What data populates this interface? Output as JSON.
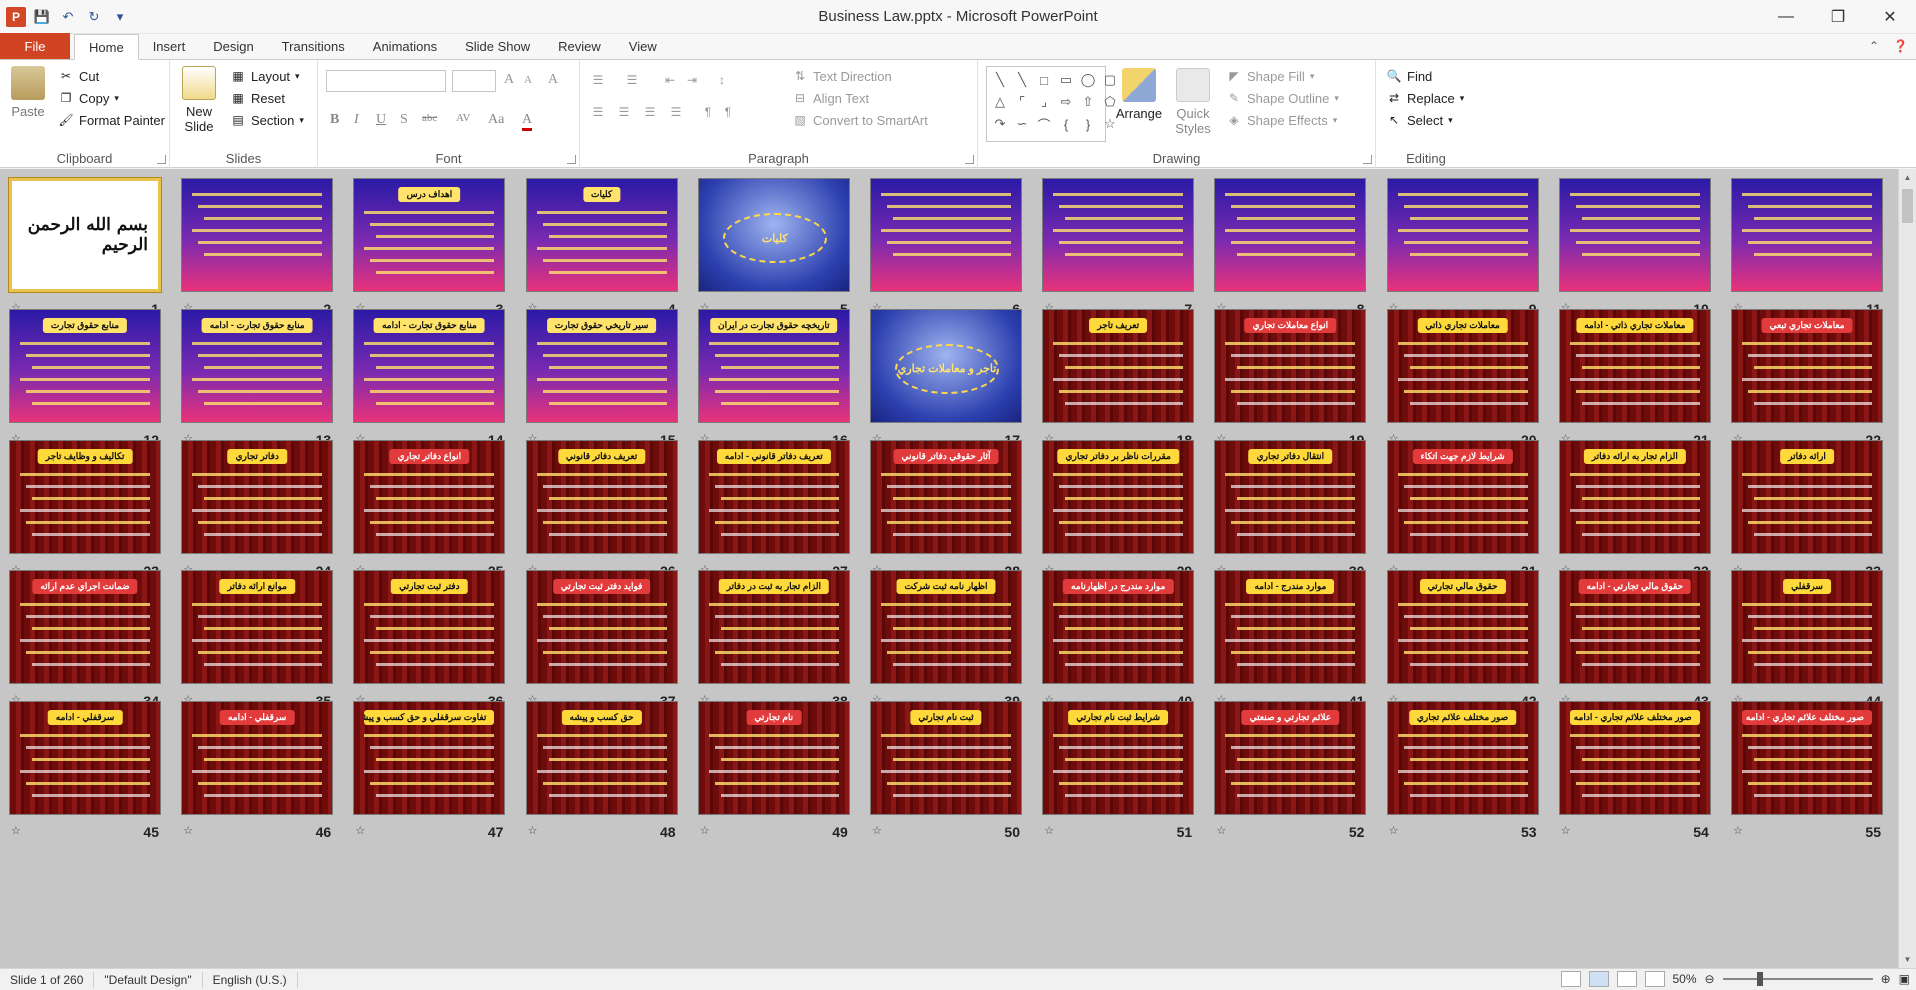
{
  "window": {
    "title": "Business Law.pptx  -  Microsoft PowerPoint"
  },
  "qat": {
    "icons": [
      "powerpoint-logo-icon",
      "save-icon",
      "undo-icon",
      "redo-icon",
      "customize-icon"
    ]
  },
  "tabs": [
    "File",
    "Home",
    "Insert",
    "Design",
    "Transitions",
    "Animations",
    "Slide Show",
    "Review",
    "View"
  ],
  "active_tab": "Home",
  "ribbon": {
    "clipboard": {
      "label": "Clipboard",
      "paste": "Paste",
      "cut": "Cut",
      "copy": "Copy",
      "format_painter": "Format Painter"
    },
    "slides": {
      "label": "Slides",
      "new_slide": "New Slide",
      "layout": "Layout",
      "reset": "Reset",
      "section": "Section"
    },
    "font": {
      "label": "Font",
      "bold": "B",
      "italic": "I",
      "underline": "U",
      "strike": "S",
      "shadow": "abc",
      "spacing": "AV",
      "case": "Aa",
      "color": "A",
      "grow": "A",
      "shrink": "A",
      "clear": "A"
    },
    "paragraph": {
      "label": "Paragraph",
      "text_direction": "Text Direction",
      "align_text": "Align Text",
      "convert_smartart": "Convert to SmartArt"
    },
    "drawing": {
      "label": "Drawing",
      "arrange": "Arrange",
      "quick_styles": "Quick Styles",
      "shape_fill": "Shape Fill",
      "shape_outline": "Shape Outline",
      "shape_effects": "Shape Effects"
    },
    "editing": {
      "label": "Editing",
      "find": "Find",
      "replace": "Replace",
      "select": "Select"
    }
  },
  "slides": [
    {
      "n": "1",
      "bg": "white",
      "title": "بسم الله الرحمن الرحيم"
    },
    {
      "n": "2",
      "bg": "purple"
    },
    {
      "n": "3",
      "bg": "purple",
      "title": "اهداف درس"
    },
    {
      "n": "4",
      "bg": "purple",
      "title": "كليات"
    },
    {
      "n": "5",
      "bg": "blue",
      "center": "كليات"
    },
    {
      "n": "6",
      "bg": "purple"
    },
    {
      "n": "7",
      "bg": "purple"
    },
    {
      "n": "8",
      "bg": "purple"
    },
    {
      "n": "9",
      "bg": "purple"
    },
    {
      "n": "10",
      "bg": "purple"
    },
    {
      "n": "11",
      "bg": "purple"
    },
    {
      "n": "12",
      "bg": "purple",
      "title": "منابع حقوق تجارت"
    },
    {
      "n": "13",
      "bg": "purple",
      "title": "منابع حقوق تجارت - ادامه"
    },
    {
      "n": "14",
      "bg": "purple",
      "title": "منابع حقوق تجارت - ادامه"
    },
    {
      "n": "15",
      "bg": "purple",
      "title": "سير تاريخي حقوق تجارت"
    },
    {
      "n": "16",
      "bg": "purple",
      "title": "تاريخچه حقوق تجارت در ايران"
    },
    {
      "n": "17",
      "bg": "blue",
      "center": "تاجر و معاملات تجاري"
    },
    {
      "n": "18",
      "bg": "red",
      "title": "تعريف تاجر"
    },
    {
      "n": "19",
      "bg": "red",
      "title": "انواع معاملات تجاري"
    },
    {
      "n": "20",
      "bg": "red",
      "title": "معاملات تجاري ذاتي"
    },
    {
      "n": "21",
      "bg": "red",
      "title": "معاملات تجاري ذاتي - ادامه"
    },
    {
      "n": "22",
      "bg": "red",
      "title": "معاملات تجاري تبعي"
    },
    {
      "n": "23",
      "bg": "red",
      "title": "تكاليف و وظايف تاجر"
    },
    {
      "n": "24",
      "bg": "red",
      "title": "دفاتر تجاري"
    },
    {
      "n": "25",
      "bg": "red",
      "title": "انواع دفاتر تجاري"
    },
    {
      "n": "26",
      "bg": "red",
      "title": "تعريف دفاتر قانوني"
    },
    {
      "n": "27",
      "bg": "red",
      "title": "تعريف دفاتر قانوني - ادامه"
    },
    {
      "n": "28",
      "bg": "red",
      "title": "آثار حقوقي دفاتر قانوني"
    },
    {
      "n": "29",
      "bg": "red",
      "title": "مقررات ناظر بر دفاتر تجاري"
    },
    {
      "n": "30",
      "bg": "red",
      "title": "انتقال دفاتر تجاري"
    },
    {
      "n": "31",
      "bg": "red",
      "title": "شرايط لازم جهت اتكاء"
    },
    {
      "n": "32",
      "bg": "red",
      "title": "الزام تجار به ارائه دفاتر"
    },
    {
      "n": "33",
      "bg": "red",
      "title": "ارائه دفاتر"
    },
    {
      "n": "34",
      "bg": "red",
      "title": "ضمانت اجراي عدم ارائه"
    },
    {
      "n": "35",
      "bg": "red",
      "title": "موانع ارائه دفاتر"
    },
    {
      "n": "36",
      "bg": "red",
      "title": "دفتر ثبت تجارتي"
    },
    {
      "n": "37",
      "bg": "red",
      "title": "فوايد دفتر ثبت تجارتي"
    },
    {
      "n": "38",
      "bg": "red",
      "title": "الزام تجار به ثبت در دفاتر"
    },
    {
      "n": "39",
      "bg": "red",
      "title": "اظهار نامه ثبت شركت"
    },
    {
      "n": "40",
      "bg": "red",
      "title": "موارد مندرج در اظهارنامه"
    },
    {
      "n": "41",
      "bg": "red",
      "title": "موارد مندرج - ادامه"
    },
    {
      "n": "42",
      "bg": "red",
      "title": "حقوق مالي تجارتي"
    },
    {
      "n": "43",
      "bg": "red",
      "title": "حقوق مالي تجارتي - ادامه"
    },
    {
      "n": "44",
      "bg": "red",
      "title": "سرقفلي"
    },
    {
      "n": "45",
      "bg": "red",
      "title": "سرقفلي - ادامه"
    },
    {
      "n": "46",
      "bg": "red",
      "title": "سرقفلي - ادامه"
    },
    {
      "n": "47",
      "bg": "red",
      "title": "تفاوت سرقفلي و حق كسب و پيشه"
    },
    {
      "n": "48",
      "bg": "red",
      "title": "حق كسب و پيشه"
    },
    {
      "n": "49",
      "bg": "red",
      "title": "نام تجارتي"
    },
    {
      "n": "50",
      "bg": "red",
      "title": "ثبت نام تجارتي"
    },
    {
      "n": "51",
      "bg": "red",
      "title": "شرايط ثبت نام تجارتي"
    },
    {
      "n": "52",
      "bg": "red",
      "title": "علائم تجارتي و صنعتي"
    },
    {
      "n": "53",
      "bg": "red",
      "title": "صور مختلف علائم تجاري"
    },
    {
      "n": "54",
      "bg": "red",
      "title": "صور مختلف علائم تجاري - ادامه"
    },
    {
      "n": "55",
      "bg": "red",
      "title": "صور مختلف علائم تجاري - ادامه"
    }
  ],
  "status": {
    "slide": "Slide 1 of 260",
    "theme": "\"Default Design\"",
    "language": "English (U.S.)",
    "zoom": "50%"
  }
}
